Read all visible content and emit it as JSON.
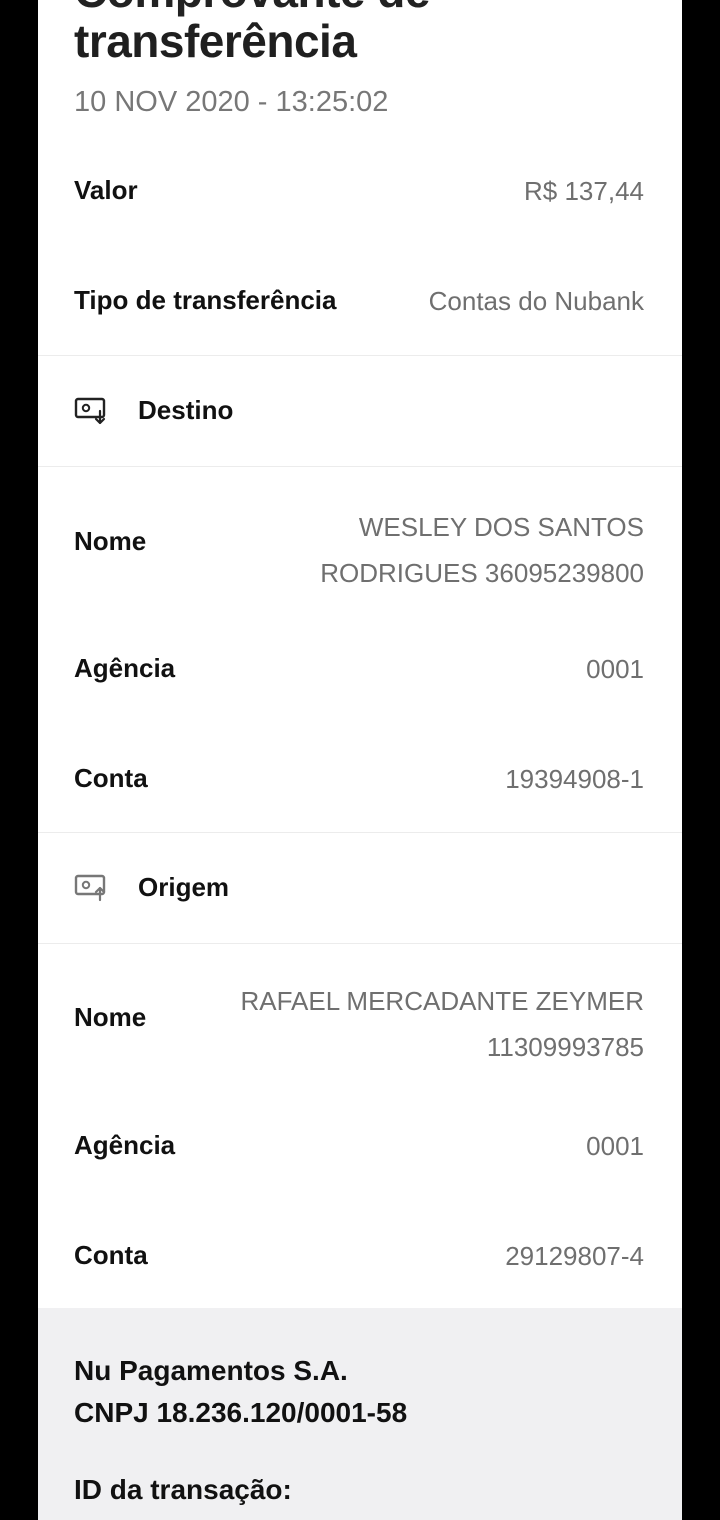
{
  "header": {
    "title_cut": "Comprovante de",
    "title": "transferência",
    "datetime": "10 NOV 2020 - 13:25:02"
  },
  "summary": {
    "value_label": "Valor",
    "value": "R$ 137,44",
    "type_label": "Tipo de transferência",
    "type": "Contas do Nubank"
  },
  "destino": {
    "section_label": "Destino",
    "icon": "receive-account-icon",
    "name_label": "Nome",
    "name_line1": "WESLEY DOS SANTOS",
    "name_line2": "RODRIGUES 36095239800",
    "agency_label": "Agência",
    "agency": "0001",
    "account_label": "Conta",
    "account": "19394908-1"
  },
  "origem": {
    "section_label": "Origem",
    "icon": "send-account-icon",
    "name_label": "Nome",
    "name_line1": "RAFAEL MERCADANTE ZEYMER",
    "name_line2": "11309993785",
    "agency_label": "Agência",
    "agency": "0001",
    "account_label": "Conta",
    "account": "29129807-4"
  },
  "footer": {
    "company_line1": "Nu Pagamentos S.A.",
    "company_line2": "CNPJ 18.236.120/0001-58",
    "transaction_id_label": "ID da transação:"
  },
  "colors": {
    "background": "#000000",
    "card": "#ffffff",
    "footer_bg": "#f0f0f2",
    "label": "#111111",
    "value": "#6f6f6f"
  }
}
